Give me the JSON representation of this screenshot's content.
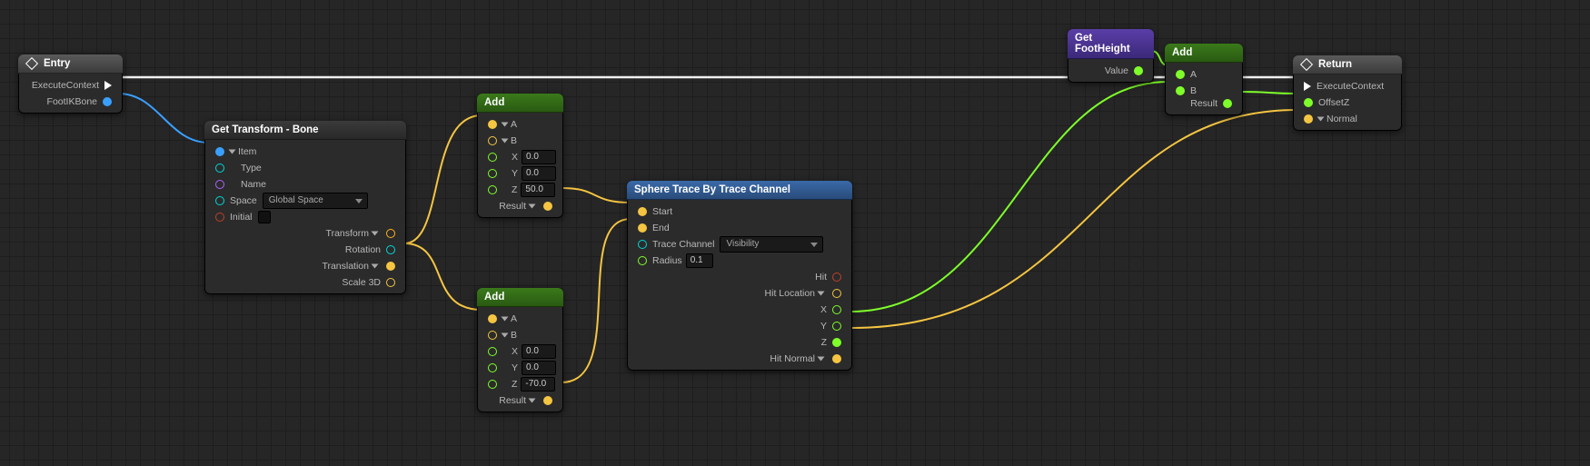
{
  "nodes": {
    "entry": {
      "title": "Entry",
      "pins": {
        "exec": "ExecuteContext",
        "bone": "FootIKBone"
      }
    },
    "getTransform": {
      "title": "Get Transform - Bone",
      "pins": {
        "item": "Item",
        "type": "Type",
        "name": "Name",
        "space": "Space",
        "spaceValue": "Global Space",
        "initial": "Initial",
        "transform": "Transform",
        "rotation": "Rotation",
        "translation": "Translation",
        "scale": "Scale 3D"
      }
    },
    "add1": {
      "title": "Add",
      "pins": {
        "a": "A",
        "b": "B",
        "x": "X",
        "xv": "0.0",
        "y": "Y",
        "yv": "0.0",
        "z": "Z",
        "zv": "50.0",
        "result": "Result"
      }
    },
    "add2": {
      "title": "Add",
      "pins": {
        "a": "A",
        "b": "B",
        "x": "X",
        "xv": "0.0",
        "y": "Y",
        "yv": "0.0",
        "z": "Z",
        "zv": "-70.0",
        "result": "Result"
      }
    },
    "sphereTrace": {
      "title": "Sphere Trace By Trace Channel",
      "pins": {
        "start": "Start",
        "end": "End",
        "traceChannel": "Trace Channel",
        "traceChannelValue": "Visibility",
        "radius": "Radius",
        "radiusValue": "0.1",
        "hit": "Hit",
        "hitLoc": "Hit Location",
        "x": "X",
        "y": "Y",
        "z": "Z",
        "hitNormal": "Hit Normal"
      }
    },
    "getFootHeight": {
      "title": "Get FootHeight",
      "pins": {
        "value": "Value"
      }
    },
    "add3": {
      "title": "Add",
      "pins": {
        "a": "A",
        "b": "B",
        "result": "Result"
      }
    },
    "return": {
      "title": "Return",
      "pins": {
        "exec": "ExecuteContext",
        "offsetZ": "OffsetZ",
        "normal": "Normal"
      }
    }
  }
}
